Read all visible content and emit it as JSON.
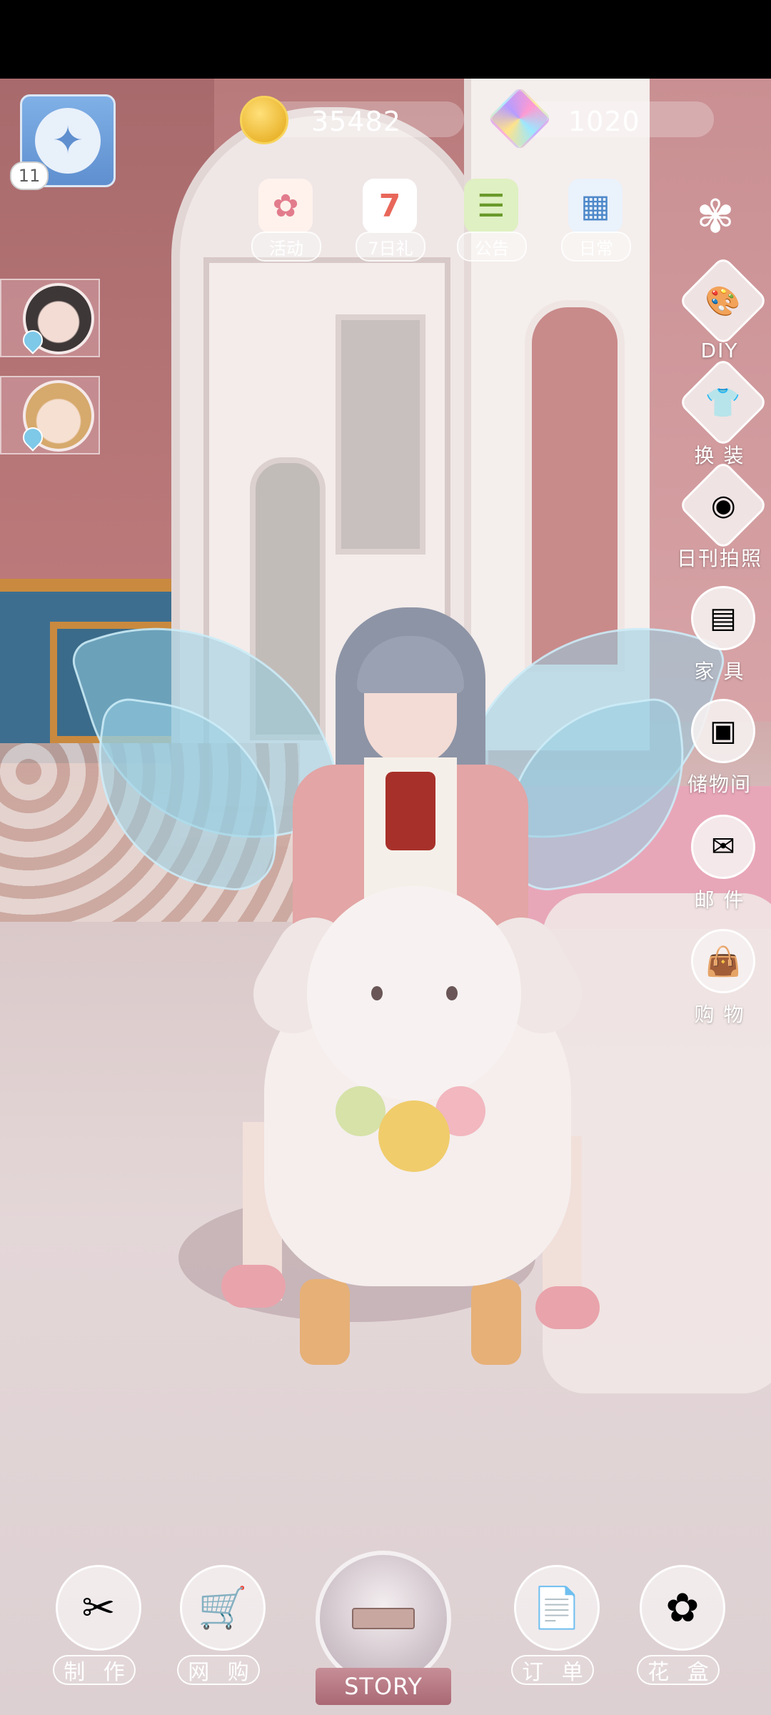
{
  "hud": {
    "player_level": "11",
    "gold": "35482",
    "gems": "1020"
  },
  "top_menu": [
    {
      "label": "活动",
      "icon": "activity-icon"
    },
    {
      "label": "7日礼",
      "icon": "seven-day-gift-icon"
    },
    {
      "label": "公告",
      "icon": "notice-icon"
    },
    {
      "label": "日常",
      "icon": "daily-calendar-icon"
    }
  ],
  "side_menu": [
    {
      "label": "DIY",
      "icon": "palette-icon"
    },
    {
      "label": "换 装",
      "icon": "outfit-icon"
    },
    {
      "label": "日刊拍照",
      "icon": "camera-icon"
    },
    {
      "label": "家 具",
      "icon": "cabinet-icon"
    },
    {
      "label": "储物间",
      "icon": "storage-icon"
    },
    {
      "label": "邮 件",
      "icon": "mail-icon"
    },
    {
      "label": "购 物",
      "icon": "shopping-bag-icon"
    }
  ],
  "bottom_menu": [
    {
      "label": "制 作",
      "icon": "craft-scissors-icon"
    },
    {
      "label": "网 购",
      "icon": "shopping-cart-icon"
    },
    {
      "label": "订 单",
      "icon": "order-paper-icon"
    },
    {
      "label": "花 盒",
      "icon": "flower-box-icon"
    }
  ],
  "story": {
    "label": "STORY"
  },
  "colors": {
    "accent": "#ffffff",
    "story_ribbon": "#b9747f"
  }
}
